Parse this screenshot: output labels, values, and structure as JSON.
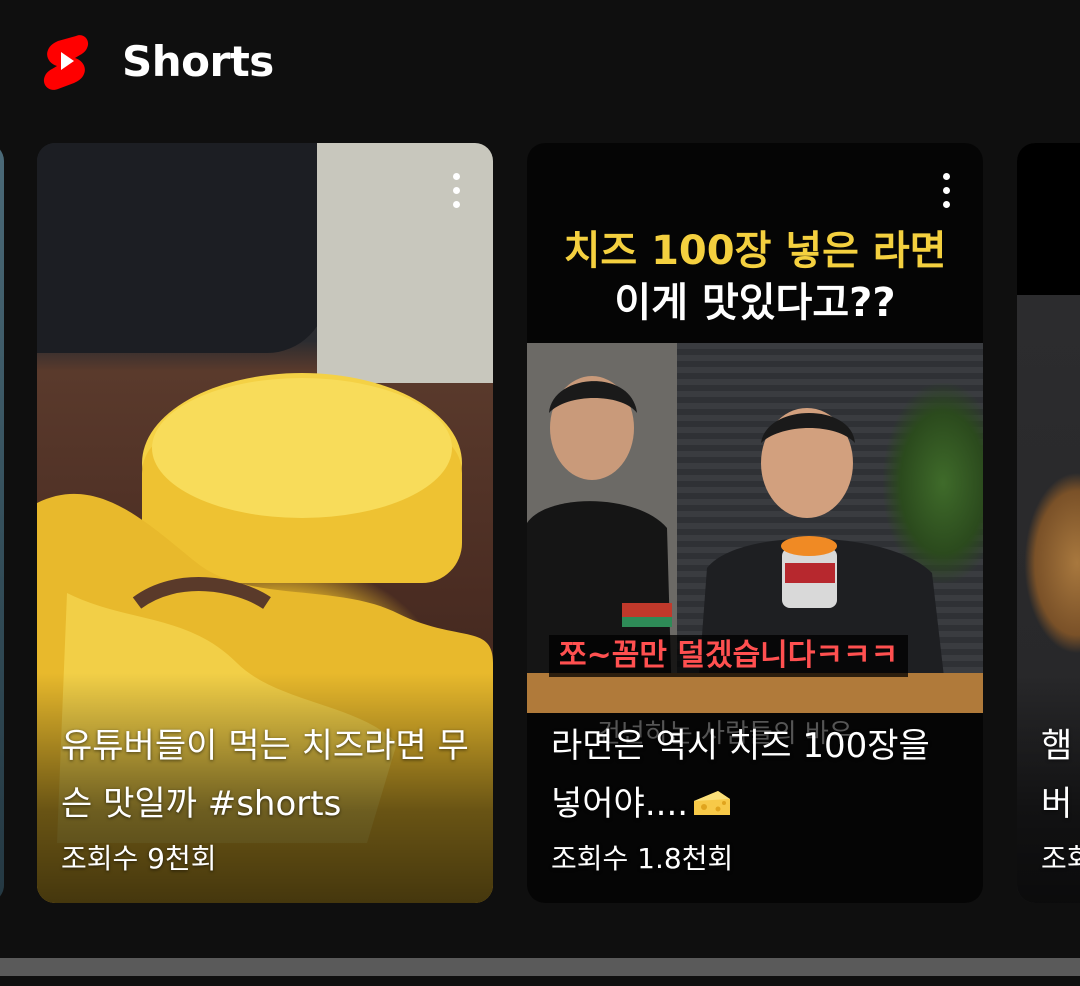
{
  "header": {
    "logo_icon": "youtube-shorts-icon",
    "title": "Shorts",
    "brand_color": "#FF0000"
  },
  "shorts": [
    {
      "title": "유튜버들이 먹는 치즈라면 무슨 맛일까 #shorts",
      "views": "조회수 9천회",
      "menu_icon": "more-vert-icon"
    },
    {
      "title": "라면은 역시 치즈 100장을 넣어야....",
      "title_emoji_icon": "cheese-icon",
      "views": "조회수 1.8천회",
      "menu_icon": "more-vert-icon",
      "thumbnail_text": {
        "line1": "치즈 100장 넣은 라면",
        "line2": "이게 맛있다고??",
        "caption": "쪼~꼼만 덜겠습니다ㅋㅋㅋ",
        "faint": "건넌하는 사람들의 바우"
      }
    },
    {
      "title": "햄버거 붓기",
      "views": "조회수"
    }
  ],
  "scrollbar": {
    "position": 0.0
  }
}
